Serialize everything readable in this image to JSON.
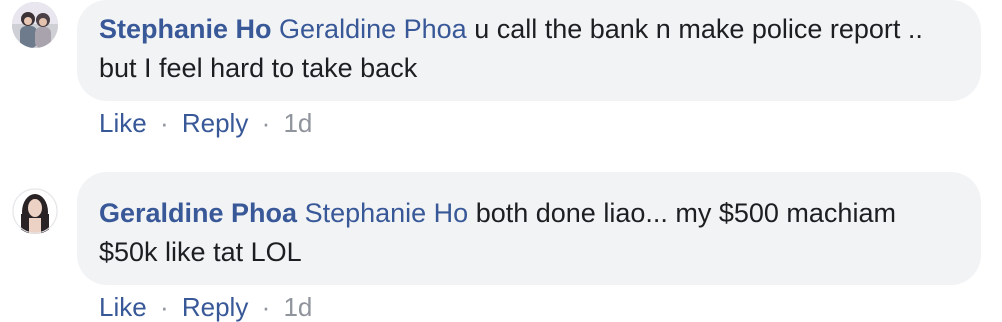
{
  "comments": [
    {
      "author": "Stephanie Ho",
      "mention": "Geraldine Phoa",
      "text": " u call the bank n make police report .. but I feel hard to take back",
      "avatar_icon": "profile-photo",
      "actions": {
        "like": "Like",
        "sep": "·",
        "reply": "Reply",
        "time": "1d"
      }
    },
    {
      "author": "Geraldine Phoa",
      "mention": "Stephanie Ho",
      "text": " both done liao... my $500 machiam $50k like tat LOL",
      "avatar_icon": "profile-photo",
      "actions": {
        "like": "Like",
        "sep": "·",
        "reply": "Reply",
        "time": "1d"
      }
    }
  ],
  "colors": {
    "link": "#385898",
    "bubble": "#f2f3f5",
    "meta": "#90949c",
    "text": "#1c1e21"
  }
}
